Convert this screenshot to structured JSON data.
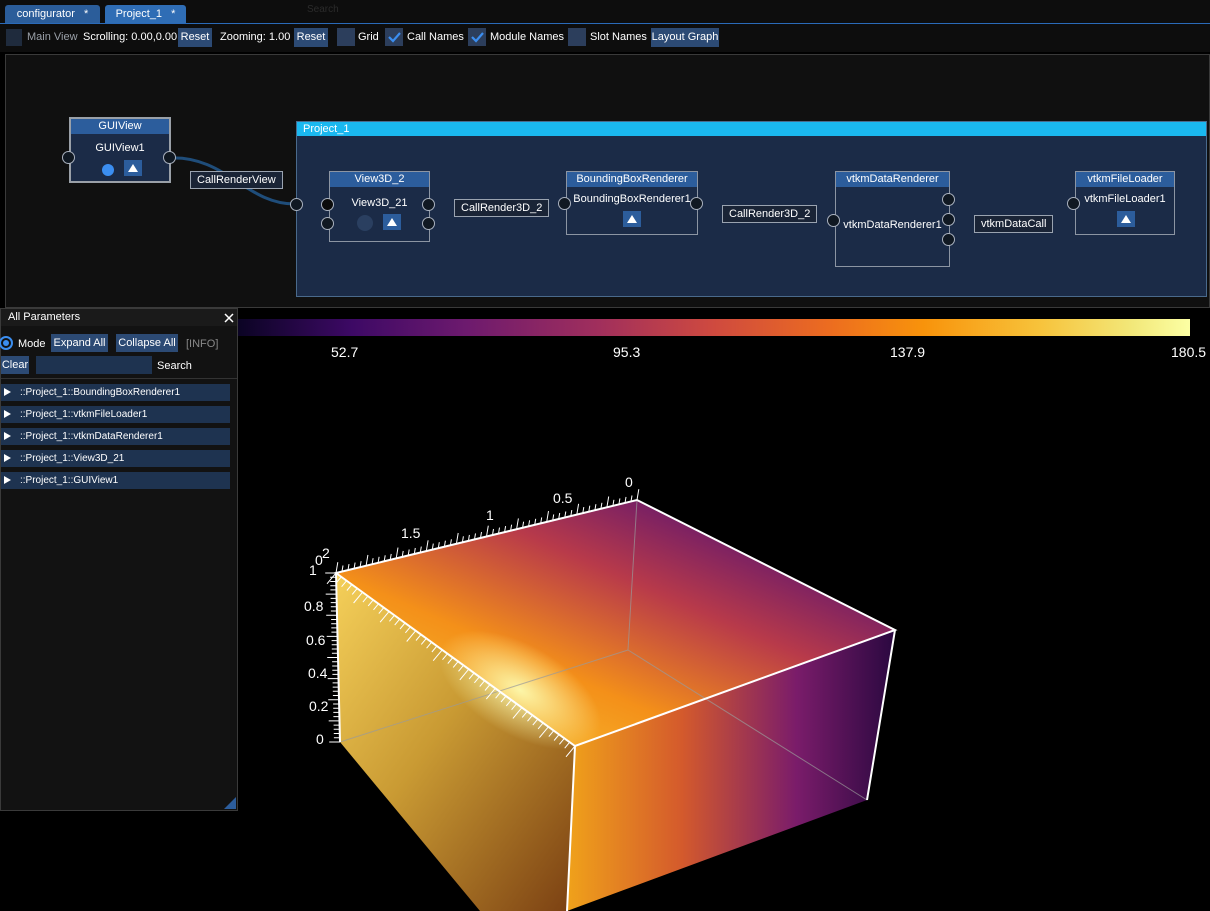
{
  "tabs": [
    {
      "label": "configurator",
      "modified": "*"
    },
    {
      "label": "Project_1",
      "modified": "*"
    }
  ],
  "ghost_search": "Search",
  "toolbar": {
    "main_view": "Main View",
    "scrolling": "Scrolling: 0.00,0.00",
    "reset1": "Reset",
    "zooming": "Zooming: 1.00",
    "reset2": "Reset",
    "grid": {
      "label": "Grid",
      "checked": false
    },
    "call_names": {
      "label": "Call Names",
      "checked": true
    },
    "module_names": {
      "label": "Module Names",
      "checked": true
    },
    "slot_names": {
      "label": "Slot Names",
      "checked": false
    },
    "layout_graph": "Layout Graph"
  },
  "graph": {
    "group_title": "Project_1",
    "modules": {
      "guiview": {
        "type": "GUIView",
        "name": "GUIView1"
      },
      "view3d": {
        "type": "View3D_2",
        "name": "View3D_21"
      },
      "bbox": {
        "type": "BoundingBoxRenderer",
        "name": "BoundingBoxRenderer1"
      },
      "vtkmdata": {
        "type": "vtkmDataRenderer",
        "name": "vtkmDataRenderer1"
      },
      "vtkmfile": {
        "type": "vtkmFileLoader",
        "name": "vtkmFileLoader1"
      }
    },
    "calls": {
      "render_view": "CallRenderView",
      "render3d_a": "CallRender3D_2",
      "render3d_b": "CallRender3D_2",
      "vtkm_data": "vtkmDataCall"
    }
  },
  "params": {
    "title": "All Parameters",
    "mode_label": "Mode",
    "expand_all": "Expand All",
    "collapse_all": "Collapse All",
    "info": "[INFO]",
    "clear": "Clear",
    "search": "Search",
    "search_value": "",
    "items": [
      "::Project_1::BoundingBoxRenderer1",
      "::Project_1::vtkmFileLoader1",
      "::Project_1::vtkmDataRenderer1",
      "::Project_1::View3D_21",
      "::Project_1::GUIView1"
    ]
  },
  "colorbar": {
    "labels": [
      "52.7",
      "95.3",
      "137.9",
      "180.5"
    ],
    "colormap": "inferno"
  },
  "axes": {
    "x_ticks": [
      "0",
      "0.5",
      "1",
      "1.5",
      "2"
    ],
    "y_ticks": [
      "0",
      "0.2",
      "0.4",
      "0.6",
      "0.8",
      "1"
    ],
    "z_origin": "0"
  },
  "colors": {
    "accent": "#2c5d9c",
    "group_header": "#1ab8f0",
    "panel_bg": "#121212"
  }
}
